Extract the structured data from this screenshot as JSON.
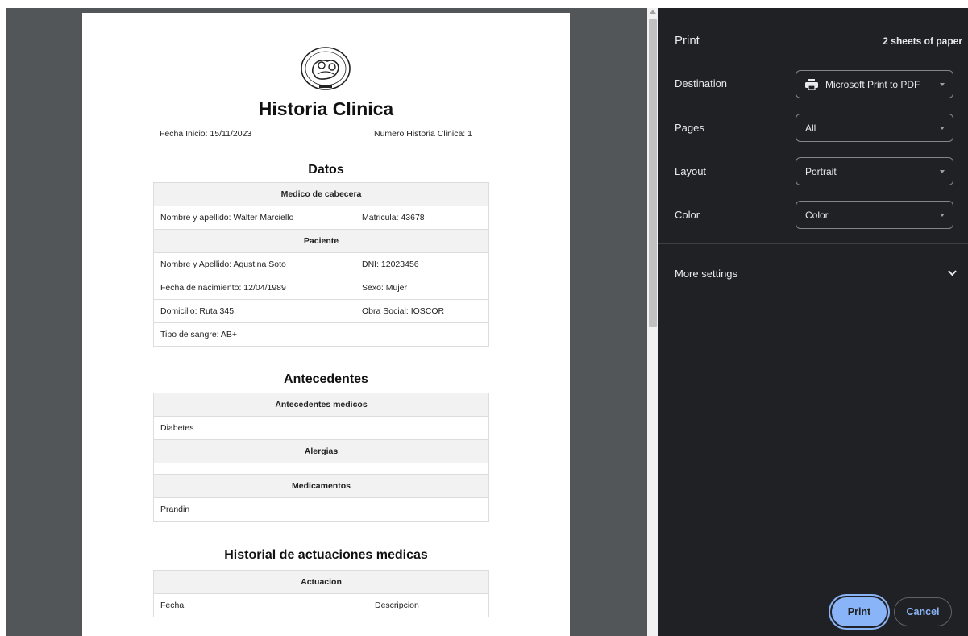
{
  "sidebar": {
    "title": "Print",
    "sheets": "2 sheets of paper",
    "destination": {
      "label": "Destination",
      "value": "Microsoft Print to PDF"
    },
    "pages": {
      "label": "Pages",
      "value": "All"
    },
    "layout": {
      "label": "Layout",
      "value": "Portrait"
    },
    "color": {
      "label": "Color",
      "value": "Color"
    },
    "more_settings": "More settings",
    "print_label": "Print",
    "cancel_label": "Cancel"
  },
  "document": {
    "title": "Historia Clinica",
    "fecha_inicio": "Fecha Inicio: 15/11/2023",
    "numero": "Numero Historia Clinica: 1",
    "datos": {
      "heading": "Datos",
      "medico_header": "Medico de cabecera",
      "medico_nombre": "Nombre y apellido: Walter Marciello",
      "medico_matricula": "Matricula: 43678",
      "paciente_header": "Paciente",
      "paciente_nombre": "Nombre y Apellido: Agustina Soto",
      "paciente_dni": "DNI: 12023456",
      "paciente_nacimiento": "Fecha de nacimiento: 12/04/1989",
      "paciente_sexo": "Sexo: Mujer",
      "paciente_domicilio": "Domicilio: Ruta 345",
      "paciente_obra": "Obra Social: IOSCOR",
      "paciente_sangre": "Tipo de sangre: AB+"
    },
    "antecedentes": {
      "heading": "Antecedentes",
      "medicos_header": "Antecedentes medicos",
      "medicos_value": "Diabetes",
      "alergias_header": "Alergias",
      "alergias_value": "",
      "medicamentos_header": "Medicamentos",
      "medicamentos_value": "Prandin"
    },
    "historial": {
      "heading": "Historial de actuaciones medicas",
      "actuacion_header": "Actuacion",
      "col_fecha": "Fecha",
      "col_descripcion": "Descripcion"
    }
  }
}
